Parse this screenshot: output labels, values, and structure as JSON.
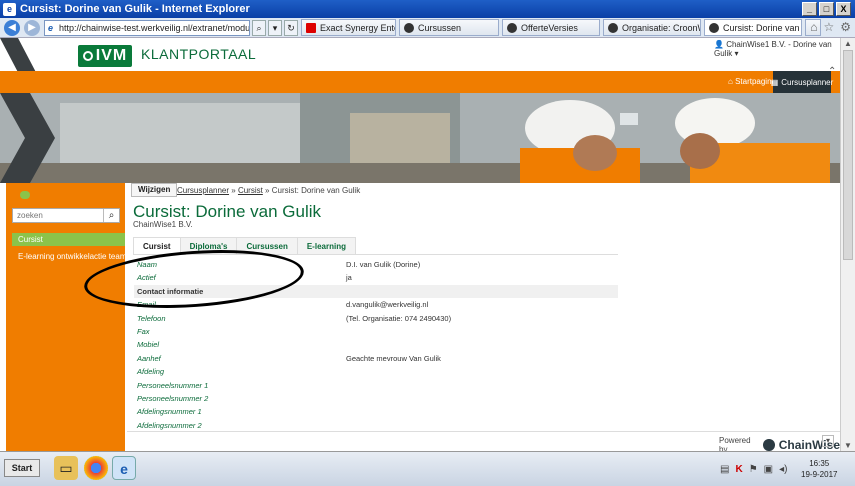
{
  "window": {
    "title": "Cursist: Dorine van Gulik - Internet Explorer",
    "controls": [
      "_",
      "□",
      "X"
    ]
  },
  "browser": {
    "address": "http://chainwise-test.werkveilig.nl/extranet/modules/cur",
    "tabs": [
      {
        "label": "Exact Synergy Enterpris..."
      },
      {
        "label": "Cursussen"
      },
      {
        "label": "OfferteVersies"
      },
      {
        "label": "Organisatie: CroonWolt..."
      },
      {
        "label": "Cursist: Dorine van ...",
        "close": "×"
      }
    ]
  },
  "header": {
    "logo_text": "IVM",
    "portal_title": "KLANTPORTAAL",
    "user": "ChainWise1 B.V. - Dorine van Gulik",
    "nav_start": "Startpagina",
    "nav_planner": "Cursusplanner"
  },
  "sidebar": {
    "search_placeholder": "zoeken",
    "items": [
      {
        "label": "Cursist"
      },
      {
        "label": "E-learning ontwikkelactie team"
      }
    ]
  },
  "main": {
    "edit_button": "Wijzigen",
    "breadcrumb": {
      "link1": "Cursusplanner",
      "sep1": " » ",
      "link2": "Cursist",
      "sep2": " » ",
      "current": "Cursist: Dorine van Gulik"
    },
    "title": "Cursist: Dorine van Gulik",
    "company": "ChainWise1 B.V.",
    "tabs": [
      "Cursist",
      "Diploma's",
      "Cursussen",
      "E-learning"
    ],
    "rows": [
      {
        "key": "Naam",
        "value": "D.I. van Gulik (Dorine)"
      },
      {
        "key": "Actief",
        "value": "ja"
      },
      {
        "key": "Contact informatie",
        "value": "",
        "section": true
      },
      {
        "key": "Email",
        "value": "d.vangulik@werkveilig.nl"
      },
      {
        "key": "Telefoon",
        "value": "(Tel. Organisatie: 074 2490430)"
      },
      {
        "key": "Fax",
        "value": ""
      },
      {
        "key": "Mobiel",
        "value": ""
      },
      {
        "key": "Aanhef",
        "value": "Geachte mevrouw Van Gulik"
      },
      {
        "key": "Afdeling",
        "value": ""
      },
      {
        "key": "Personeelsnummer 1",
        "value": ""
      },
      {
        "key": "Personeelsnummer 2",
        "value": ""
      },
      {
        "key": "Afdelingsnummer 1",
        "value": ""
      },
      {
        "key": "Afdelingsnummer 2",
        "value": ""
      }
    ]
  },
  "footer": {
    "powered_by": "Powered by",
    "brand": "ChainWise"
  },
  "taskbar": {
    "start": "Start",
    "time": "16:35",
    "date": "19-9-2017"
  },
  "colors": {
    "orange": "#f07d00",
    "green": "#0b6b3a",
    "lightgreen": "#8bc34a",
    "dark": "#263238"
  }
}
